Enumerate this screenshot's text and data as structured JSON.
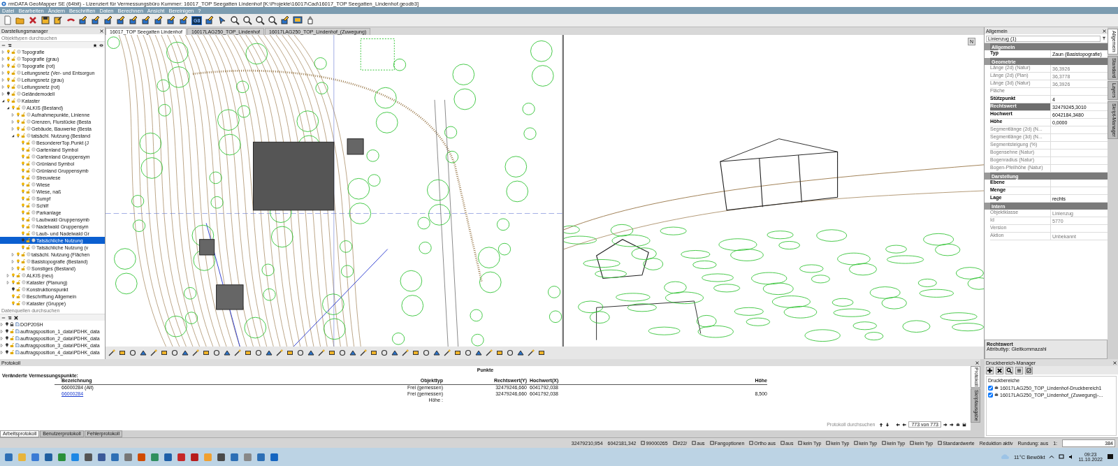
{
  "window": {
    "title": "rmDATA GeoMapper SE (64bit) - Lizenziert für Vermessungsbüro Kummer: 16017_TOP Seegatten Lindenhof [K:\\Projekte\\16017\\Cad\\16017_TOP Seegatten_Lindenhof.geodb3]"
  },
  "menu": [
    "Datei",
    "Bearbeiten",
    "Ändern",
    "Beschriften",
    "Daten",
    "Berechnen",
    "Ansicht",
    "Bereinigen",
    "?"
  ],
  "toolbar": {
    "badge": "G8"
  },
  "layer_panel": {
    "title": "Darstellungsmanager",
    "search": {
      "placeholder": "Objekttypen durchsuchen"
    },
    "items": [
      {
        "label": "Topografie",
        "expanded": false,
        "visible": true,
        "selected": false
      },
      {
        "label": "Topografie (grau)",
        "expanded": false,
        "visible": true,
        "selected": false
      },
      {
        "label": "Topografie (rot)",
        "expanded": false,
        "visible": true,
        "selected": false
      },
      {
        "label": "Leitungsnetz (Ver- und Entsorgun",
        "expanded": false,
        "visible": true,
        "selected": false
      },
      {
        "label": "Leitungsnetz (grau)",
        "expanded": false,
        "visible": true,
        "selected": false
      },
      {
        "label": "Leitungsnetz (rot)",
        "expanded": false,
        "visible": true,
        "selected": false
      },
      {
        "label": "Geländemodell",
        "expanded": false,
        "visible": false,
        "selected": false
      },
      {
        "label": "Kataster",
        "expanded": true,
        "visible": true,
        "selected": false,
        "children": [
          {
            "label": "ALKIS (Bestand)",
            "expanded": true,
            "visible": true,
            "selected": false,
            "children": [
              {
                "label": "Aufnahmepunkte, Linienne",
                "expanded": false,
                "visible": true,
                "selected": false
              },
              {
                "label": "Grenzen, Flurstücke (Besta",
                "expanded": false,
                "visible": true,
                "selected": false
              },
              {
                "label": "Gebäude, Bauwerke (Besta",
                "expanded": false,
                "visible": true,
                "selected": false
              },
              {
                "label": "tatsächl. Nutzung (Bestand",
                "expanded": true,
                "visible": true,
                "selected": false,
                "children": [
                  {
                    "label": "BesondererTop.Punkt (J",
                    "visible": true,
                    "selected": false
                  },
                  {
                    "label": "Gartenland Symbol",
                    "visible": true,
                    "selected": false
                  },
                  {
                    "label": "Gartenland Gruppensym",
                    "visible": true,
                    "selected": false
                  },
                  {
                    "label": "Grünland Symbol",
                    "visible": true,
                    "selected": false
                  },
                  {
                    "label": "Grünland Gruppensymb",
                    "visible": true,
                    "selected": false
                  },
                  {
                    "label": "Streuwiese",
                    "visible": true,
                    "selected": false
                  },
                  {
                    "label": "Wiese",
                    "visible": true,
                    "selected": false
                  },
                  {
                    "label": "Wiese, naß",
                    "visible": true,
                    "selected": false
                  },
                  {
                    "label": "Sumpf",
                    "visible": true,
                    "selected": false
                  },
                  {
                    "label": "Schilf",
                    "visible": true,
                    "selected": false
                  },
                  {
                    "label": "Parkanlage",
                    "visible": true,
                    "selected": false
                  },
                  {
                    "label": "Laubwald Gruppensymb",
                    "visible": true,
                    "selected": false
                  },
                  {
                    "label": "Nadelwald Gruppensym",
                    "visible": true,
                    "selected": false
                  },
                  {
                    "label": "Laub- und Nadelwald Gr",
                    "visible": true,
                    "selected": false
                  },
                  {
                    "label": "Tatsächliche Nutzung",
                    "visible": false,
                    "selected": true
                  },
                  {
                    "label": "Tatsächliche Nutzung (v",
                    "visible": true,
                    "selected": false
                  }
                ]
              },
              {
                "label": "tatsächl. Nutzung (Flächen",
                "expanded": false,
                "visible": true,
                "selected": false
              },
              {
                "label": "Basistopografie (Bestand)",
                "expanded": false,
                "visible": true,
                "selected": false
              },
              {
                "label": "Sonstiges (Bestand)",
                "expanded": false,
                "visible": true,
                "selected": false
              }
            ]
          },
          {
            "label": "ALKIS (neu)",
            "expanded": false,
            "visible": true,
            "selected": false
          },
          {
            "label": "Kataster (Planung)",
            "expanded": false,
            "visible": true,
            "selected": false
          },
          {
            "label": "Konstruktionspunkt",
            "visible": false,
            "selected": false
          },
          {
            "label": "Beschriftung Allgemein",
            "visible": true,
            "selected": false
          },
          {
            "label": "Kataster (Gruppe)",
            "visible": true,
            "selected": false
          }
        ]
      }
    ]
  },
  "data_panel": {
    "search": {
      "placeholder": "Datenquellen durchsuchen"
    },
    "items": [
      {
        "label": "DOP20SH",
        "locked": true
      },
      {
        "label": "auftragsposition_1_data\\PDHK_data",
        "locked": false
      },
      {
        "label": "auftragsposition_2_data\\PDHK_data",
        "locked": false
      },
      {
        "label": "auftragsposition_3_data\\PDHK_data",
        "locked": false
      },
      {
        "label": "auftragsposition_4_data\\PDHK_data",
        "locked": false
      }
    ]
  },
  "document_tabs": [
    {
      "label": "16017_TOP Seegatten Lindenhof",
      "selected": true
    },
    {
      "label": "16017LAG250_TOP_Lindenhof",
      "selected": false
    },
    {
      "label": "16017LAG250_TOP_Lindenhof_(Zuwegung)",
      "selected": false
    }
  ],
  "view_3d": {
    "compass": "N"
  },
  "properties": {
    "title": "Allgemein",
    "selector": "Linienzug (1)",
    "sections": [
      {
        "title": "Allgemein",
        "rows": [
          {
            "label": "Typ",
            "value": "Zaun (Basistopografie)",
            "editable": true,
            "selected": false
          }
        ]
      },
      {
        "title": "Geometrie",
        "rows": [
          {
            "label": "Länge (2d) (Natur)",
            "value": "36,3926",
            "editable": false,
            "selected": false
          },
          {
            "label": "Länge (2d) (Plan)",
            "value": "36,3778",
            "editable": false,
            "selected": false
          },
          {
            "label": "Länge (3d) (Natur)",
            "value": "36,3926",
            "editable": false,
            "selected": false
          },
          {
            "label": "Fläche",
            "editable": false,
            "selected": false
          },
          {
            "label": "Stützpunkt",
            "value": "4",
            "editable": true,
            "selected": false
          },
          {
            "label": "Rechtswert",
            "value": "32479245,3010",
            "editable": true,
            "selected": true
          },
          {
            "label": "Hochwert",
            "value": "6042184,3480",
            "editable": true,
            "selected": false
          },
          {
            "label": "Höhe",
            "value": "0,0000",
            "editable": true,
            "selected": false
          },
          {
            "label": "Segmentlänge (2d) (N...",
            "editable": false,
            "selected": false
          },
          {
            "label": "Segmentlänge (3d) (N...",
            "editable": false,
            "selected": false
          },
          {
            "label": "Segmentsteigung (%)",
            "editable": false,
            "selected": false
          },
          {
            "label": "Bogensehne (Natur)",
            "editable": false,
            "selected": false
          },
          {
            "label": "Bogenradius (Natur)",
            "editable": false,
            "selected": false
          },
          {
            "label": "Bogen-Pfeilhöhe (Natur)",
            "editable": false,
            "selected": false
          }
        ]
      },
      {
        "title": "Darstellung",
        "rows": [
          {
            "label": "Ebene",
            "editable": true,
            "selected": false
          },
          {
            "label": "Menge",
            "editable": true,
            "selected": false
          },
          {
            "label": "Lage",
            "value": "rechts",
            "editable": true,
            "selected": false
          }
        ]
      },
      {
        "title": "Intern",
        "rows": [
          {
            "label": "Objektklasse",
            "value": "Linienzug",
            "editable": false,
            "selected": false
          },
          {
            "label": "Id",
            "value": "5770",
            "editable": false,
            "selected": false
          },
          {
            "label": "Version",
            "editable": false,
            "selected": false
          },
          {
            "label": "Aktion",
            "value": "Unbekannt",
            "editable": false,
            "selected": false
          }
        ]
      }
    ],
    "footer": {
      "title": "Rechtswert",
      "text": "Attributtyp: Gleitkommazahl"
    }
  },
  "side_tabs": [
    {
      "label": "Allgemein",
      "selected": true
    },
    {
      "label": "Standard",
      "selected": false
    },
    {
      "label": "Layers",
      "selected": false
    },
    {
      "label": "Skript-Manager",
      "selected": false
    }
  ],
  "protocol": {
    "title": "Protokoll",
    "heading": "Punkte",
    "subheading": "Veränderte Vermessungspunkte:",
    "columns": [
      "Bezeichnung",
      "Objekttyp",
      "Rechtswert(Y)",
      "Hochwert(X)",
      "Höhe"
    ],
    "rows": [
      {
        "kind": "plain",
        "cells": [
          "66000284 (Alt)",
          "Frei (gemessen)",
          "32479246,660",
          "6041792,038",
          ""
        ]
      },
      {
        "kind": "link",
        "cells": [
          "66000284",
          "Frei (gemessen)",
          "32479246,660",
          "6041792,038",
          "8,500"
        ]
      },
      {
        "kind": "plain",
        "cells": [
          "",
          "Höhe :",
          "",
          "",
          ""
        ]
      }
    ],
    "search_label": "Protokoll durchsuchen",
    "counter": "773 von 773",
    "tabs": [
      {
        "label": "Arbeitsprotokoll",
        "selected": true
      },
      {
        "label": "Benutzerprotokoll",
        "selected": false
      },
      {
        "label": "Fehlerprotokoll",
        "selected": false
      }
    ],
    "side_tabs": [
      {
        "label": "Protokoll",
        "selected": true
      },
      {
        "label": "Skriptausgabe",
        "selected": false
      }
    ]
  },
  "print_manager": {
    "title": "Druckbereich-Manager",
    "heading": "Druckbereiche",
    "items": [
      {
        "label": "16017LAG250_TOP_Lindenhof-Druckbereich1",
        "checked": true
      },
      {
        "label": "16017LAG250_TOP_Lindenhof_(Zuwegung)-...",
        "checked": true
      }
    ]
  },
  "status_bar": {
    "easting": "32479210,954",
    "northing": "6042181,342",
    "items": [
      "99000265",
      "#22/",
      "aus",
      "Fangoptionen",
      "Ortho aus",
      "aus",
      "kein Typ",
      "kein Typ",
      "kein Typ",
      "kein Typ",
      "kein Typ",
      "Standardwerte"
    ],
    "reduction": "Reduktion aktiv",
    "rounding": "Rundung: aus",
    "scale_label": "1:",
    "scale": "384"
  },
  "taskbar": {
    "weather": "11°C  Bewölkt",
    "time": "09:23",
    "date": "11.10.2022"
  }
}
